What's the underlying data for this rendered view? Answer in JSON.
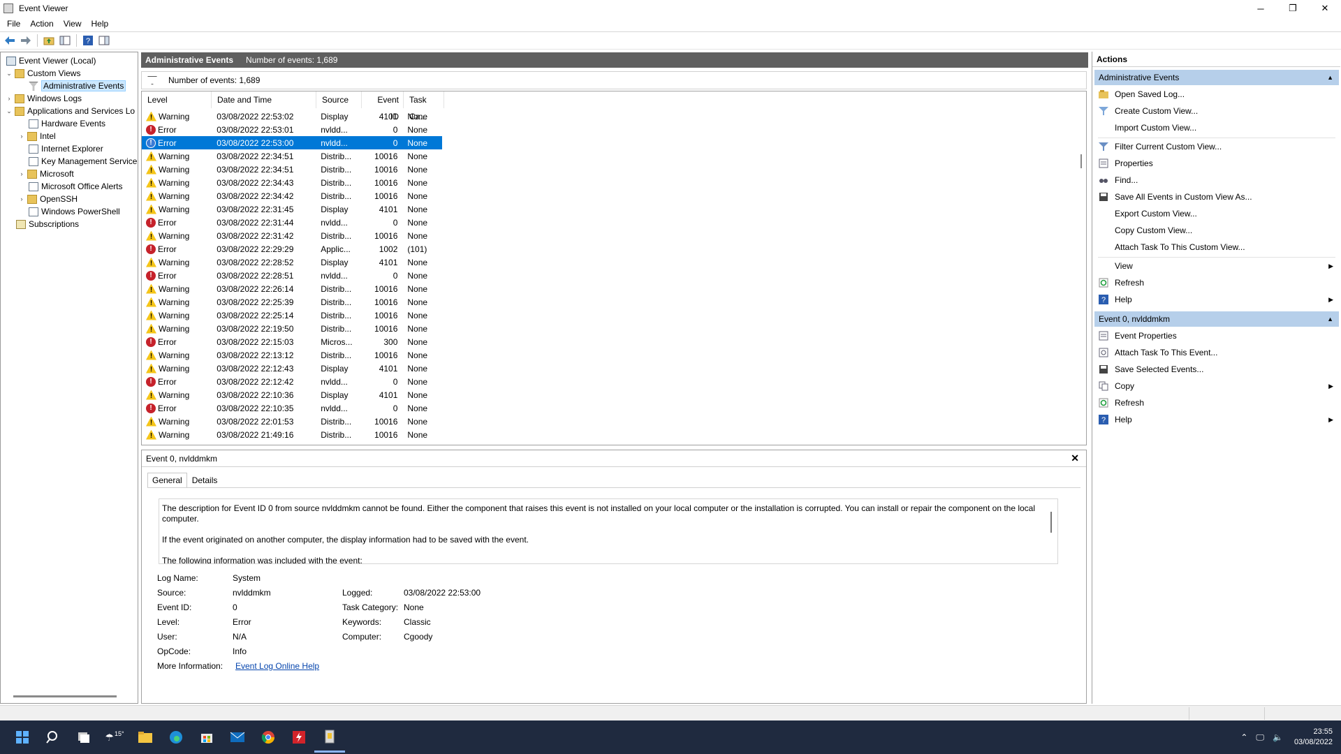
{
  "window": {
    "title": "Event Viewer",
    "minimize": "─",
    "restore": "❐",
    "close": "✕"
  },
  "menu": [
    "File",
    "Action",
    "View",
    "Help"
  ],
  "toolbar": [
    "back-icon",
    "forward-icon",
    "folder-up-icon",
    "show-hide-icon",
    "help-icon",
    "properties-icon"
  ],
  "tree": {
    "root": "Event Viewer (Local)",
    "items": [
      {
        "label": "Custom Views",
        "icon": "folder-icon"
      },
      {
        "label": "Administrative Events",
        "icon": "filter-icon"
      },
      {
        "label": "Windows Logs",
        "icon": "folder-icon"
      },
      {
        "label": "Applications and Services Lo",
        "icon": "folder-icon"
      },
      {
        "label": "Hardware Events",
        "icon": "log-icon"
      },
      {
        "label": "Intel",
        "icon": "folder-icon"
      },
      {
        "label": "Internet Explorer",
        "icon": "log-icon"
      },
      {
        "label": "Key Management Service",
        "icon": "log-icon"
      },
      {
        "label": "Microsoft",
        "icon": "folder-icon"
      },
      {
        "label": "Microsoft Office Alerts",
        "icon": "log-icon"
      },
      {
        "label": "OpenSSH",
        "icon": "folder-icon"
      },
      {
        "label": "Windows PowerShell",
        "icon": "log-icon"
      },
      {
        "label": "Subscriptions",
        "icon": "subscriptions-icon"
      }
    ]
  },
  "center": {
    "title": "Administrative Events",
    "count": "Number of events: 1,689",
    "filter_text": "Number of events: 1,689"
  },
  "grid": {
    "columns": [
      "Level",
      "Date and Time",
      "Source",
      "Event ID",
      "Task Ca..."
    ],
    "rows": [
      {
        "level": "Warning",
        "date": "03/08/2022 22:53:02",
        "source": "Display",
        "id": "4101",
        "task": "None"
      },
      {
        "level": "Error",
        "date": "03/08/2022 22:53:01",
        "source": "nvldd...",
        "id": "0",
        "task": "None"
      },
      {
        "level": "Error",
        "date": "03/08/2022 22:53:00",
        "source": "nvldd...",
        "id": "0",
        "task": "None"
      },
      {
        "level": "Warning",
        "date": "03/08/2022 22:34:51",
        "source": "Distrib...",
        "id": "10016",
        "task": "None"
      },
      {
        "level": "Warning",
        "date": "03/08/2022 22:34:51",
        "source": "Distrib...",
        "id": "10016",
        "task": "None"
      },
      {
        "level": "Warning",
        "date": "03/08/2022 22:34:43",
        "source": "Distrib...",
        "id": "10016",
        "task": "None"
      },
      {
        "level": "Warning",
        "date": "03/08/2022 22:34:42",
        "source": "Distrib...",
        "id": "10016",
        "task": "None"
      },
      {
        "level": "Warning",
        "date": "03/08/2022 22:31:45",
        "source": "Display",
        "id": "4101",
        "task": "None"
      },
      {
        "level": "Error",
        "date": "03/08/2022 22:31:44",
        "source": "nvldd...",
        "id": "0",
        "task": "None"
      },
      {
        "level": "Warning",
        "date": "03/08/2022 22:31:42",
        "source": "Distrib...",
        "id": "10016",
        "task": "None"
      },
      {
        "level": "Error",
        "date": "03/08/2022 22:29:29",
        "source": "Applic...",
        "id": "1002",
        "task": "(101)"
      },
      {
        "level": "Warning",
        "date": "03/08/2022 22:28:52",
        "source": "Display",
        "id": "4101",
        "task": "None"
      },
      {
        "level": "Error",
        "date": "03/08/2022 22:28:51",
        "source": "nvldd...",
        "id": "0",
        "task": "None"
      },
      {
        "level": "Warning",
        "date": "03/08/2022 22:26:14",
        "source": "Distrib...",
        "id": "10016",
        "task": "None"
      },
      {
        "level": "Warning",
        "date": "03/08/2022 22:25:39",
        "source": "Distrib...",
        "id": "10016",
        "task": "None"
      },
      {
        "level": "Warning",
        "date": "03/08/2022 22:25:14",
        "source": "Distrib...",
        "id": "10016",
        "task": "None"
      },
      {
        "level": "Warning",
        "date": "03/08/2022 22:19:50",
        "source": "Distrib...",
        "id": "10016",
        "task": "None"
      },
      {
        "level": "Error",
        "date": "03/08/2022 22:15:03",
        "source": "Micros...",
        "id": "300",
        "task": "None"
      },
      {
        "level": "Warning",
        "date": "03/08/2022 22:13:12",
        "source": "Distrib...",
        "id": "10016",
        "task": "None"
      },
      {
        "level": "Warning",
        "date": "03/08/2022 22:12:43",
        "source": "Display",
        "id": "4101",
        "task": "None"
      },
      {
        "level": "Error",
        "date": "03/08/2022 22:12:42",
        "source": "nvldd...",
        "id": "0",
        "task": "None"
      },
      {
        "level": "Warning",
        "date": "03/08/2022 22:10:36",
        "source": "Display",
        "id": "4101",
        "task": "None"
      },
      {
        "level": "Error",
        "date": "03/08/2022 22:10:35",
        "source": "nvldd...",
        "id": "0",
        "task": "None"
      },
      {
        "level": "Warning",
        "date": "03/08/2022 22:01:53",
        "source": "Distrib...",
        "id": "10016",
        "task": "None"
      },
      {
        "level": "Warning",
        "date": "03/08/2022 21:49:16",
        "source": "Distrib...",
        "id": "10016",
        "task": "None"
      }
    ],
    "selected_index": 2
  },
  "detail": {
    "title": "Event 0, nvlddmkm",
    "close": "✕",
    "tabs": [
      "General",
      "Details"
    ],
    "active_tab": "General",
    "description": [
      "The description for Event ID 0 from source nvlddmkm cannot be found. Either the component that raises this event is not installed on your local computer or the installation is corrupted. You can install or repair the component on the local computer.",
      "If the event originated on another computer, the display information had to be saved with the event.",
      "The following information was included with the event:"
    ],
    "props_left": [
      {
        "label": "Log Name:",
        "value": "System"
      },
      {
        "label": "Source:",
        "value": "nvlddmkm"
      },
      {
        "label": "Event ID:",
        "value": "0"
      },
      {
        "label": "Level:",
        "value": "Error"
      },
      {
        "label": "User:",
        "value": "N/A"
      },
      {
        "label": "OpCode:",
        "value": "Info"
      },
      {
        "label": "More Information:",
        "value": "Event Log Online Help"
      }
    ],
    "props_right": [
      {
        "label": "Logged:",
        "value": "03/08/2022 22:53:00"
      },
      {
        "label": "Task Category:",
        "value": "None"
      },
      {
        "label": "Keywords:",
        "value": "Classic"
      },
      {
        "label": "Computer:",
        "value": "Cgoody"
      }
    ]
  },
  "actions": {
    "title": "Actions",
    "section1": {
      "label": "Administrative Events",
      "items": [
        {
          "label": "Open Saved Log...",
          "icon": "open-log-icon",
          "submenu": false
        },
        {
          "label": "Create Custom View...",
          "icon": "create-view-icon",
          "submenu": false
        },
        {
          "label": "Import Custom View...",
          "icon": "",
          "submenu": false
        },
        {
          "label": "Filter Current Custom View...",
          "icon": "filter-icon",
          "submenu": false
        },
        {
          "label": "Properties",
          "icon": "properties-icon",
          "submenu": false
        },
        {
          "label": "Find...",
          "icon": "find-icon",
          "submenu": false
        },
        {
          "label": "Save All Events in Custom View As...",
          "icon": "save-icon",
          "submenu": false
        },
        {
          "label": "Export Custom View...",
          "icon": "",
          "submenu": false
        },
        {
          "label": "Copy Custom View...",
          "icon": "",
          "submenu": false
        },
        {
          "label": "Attach Task To This Custom View...",
          "icon": "",
          "submenu": false
        },
        {
          "label": "View",
          "icon": "",
          "submenu": true
        },
        {
          "label": "Refresh",
          "icon": "refresh-icon",
          "submenu": false
        },
        {
          "label": "Help",
          "icon": "help-icon",
          "submenu": true
        }
      ]
    },
    "section2": {
      "label": "Event 0, nvlddmkm",
      "items": [
        {
          "label": "Event Properties",
          "icon": "event-properties-icon",
          "submenu": false
        },
        {
          "label": "Attach Task To This Event...",
          "icon": "attach-task-icon",
          "submenu": false
        },
        {
          "label": "Save Selected Events...",
          "icon": "save-icon",
          "submenu": false
        },
        {
          "label": "Copy",
          "icon": "copy-icon",
          "submenu": true
        },
        {
          "label": "Refresh",
          "icon": "refresh-icon",
          "submenu": false
        },
        {
          "label": "Help",
          "icon": "help-icon",
          "submenu": true
        }
      ]
    }
  },
  "taskbar": {
    "apps": [
      "start-icon",
      "search-icon",
      "task-view-icon",
      "weather-icon",
      "file-explorer-icon",
      "edge-icon",
      "store-icon",
      "mail-icon",
      "chrome-icon",
      "app-icon",
      "event-viewer-icon"
    ],
    "weather": "15°",
    "time": "23:55",
    "date": "03/08/2022"
  },
  "colors": {
    "selection": "#0078d7",
    "section_header": "#b6cfea",
    "center_header": "#5f5f5f",
    "taskbar": "#1f2a3f",
    "error": "#c6222b",
    "warning": "#f5c518",
    "link": "#0645ad"
  }
}
